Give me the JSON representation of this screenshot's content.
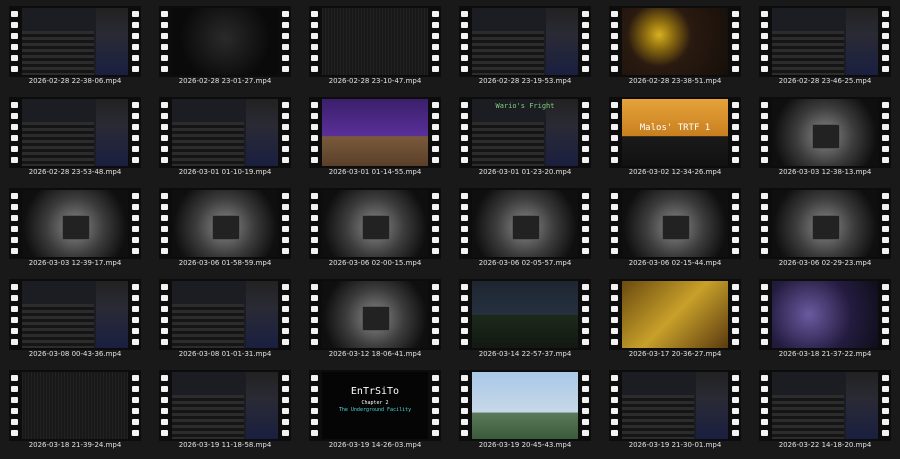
{
  "items": [
    {
      "name": "2026-02-28 22-38-06.mp4",
      "scene": "ui"
    },
    {
      "name": "2026-02-28 23-01-27.mp4",
      "scene": "dark"
    },
    {
      "name": "2026-02-28 23-10-47.mp4",
      "scene": "noise"
    },
    {
      "name": "2026-02-28 23-19-53.mp4",
      "scene": "ui"
    },
    {
      "name": "2026-02-28 23-38-51.mp4",
      "scene": "face"
    },
    {
      "name": "2026-02-28 23-46-25.mp4",
      "scene": "ui"
    },
    {
      "name": "2026-02-28 23-53-48.mp4",
      "scene": "ui"
    },
    {
      "name": "2026-03-01 01-10-19.mp4",
      "scene": "ui"
    },
    {
      "name": "2026-03-01 01-14-55.mp4",
      "scene": "purple"
    },
    {
      "name": "2026-03-01 01-23-20.mp4",
      "scene": "ui",
      "title": "Wario's Fright"
    },
    {
      "name": "2026-03-02 12-34-26.mp4",
      "scene": "orange",
      "title": "Malos' TRTF 1"
    },
    {
      "name": "2026-03-03 12-38-13.mp4",
      "scene": "help"
    },
    {
      "name": "2026-03-03 12-39-17.mp4",
      "scene": "help"
    },
    {
      "name": "2026-03-06 01-58-59.mp4",
      "scene": "help"
    },
    {
      "name": "2026-03-06 02-00-15.mp4",
      "scene": "help"
    },
    {
      "name": "2026-03-06 02-05-57.mp4",
      "scene": "help"
    },
    {
      "name": "2026-03-06 02-15-44.mp4",
      "scene": "help"
    },
    {
      "name": "2026-03-06 02-29-23.mp4",
      "scene": "help"
    },
    {
      "name": "2026-03-08 00-43-36.mp4",
      "scene": "ui"
    },
    {
      "name": "2026-03-08 01-01-31.mp4",
      "scene": "ui"
    },
    {
      "name": "2026-03-12 18-06-41.mp4",
      "scene": "help"
    },
    {
      "name": "2026-03-14 22-57-37.mp4",
      "scene": "night"
    },
    {
      "name": "2026-03-17 20-36-27.mp4",
      "scene": "yellow"
    },
    {
      "name": "2026-03-18 21-37-22.mp4",
      "scene": "blue"
    },
    {
      "name": "2026-03-18 21-39-24.mp4",
      "scene": "noise"
    },
    {
      "name": "2026-03-19 11-18-58.mp4",
      "scene": "ui"
    },
    {
      "name": "2026-03-19 14-26-03.mp4",
      "scene": "black",
      "title": "EnTrSiTo",
      "subtitle": "Chapter 2",
      "tagline": "The Underground Facility"
    },
    {
      "name": "2026-03-19 20-45-43.mp4",
      "scene": "sky"
    },
    {
      "name": "2026-03-19 21-30-01.mp4",
      "scene": "ui"
    },
    {
      "name": "2026-03-22 14-18-20.mp4",
      "scene": "ui"
    }
  ]
}
